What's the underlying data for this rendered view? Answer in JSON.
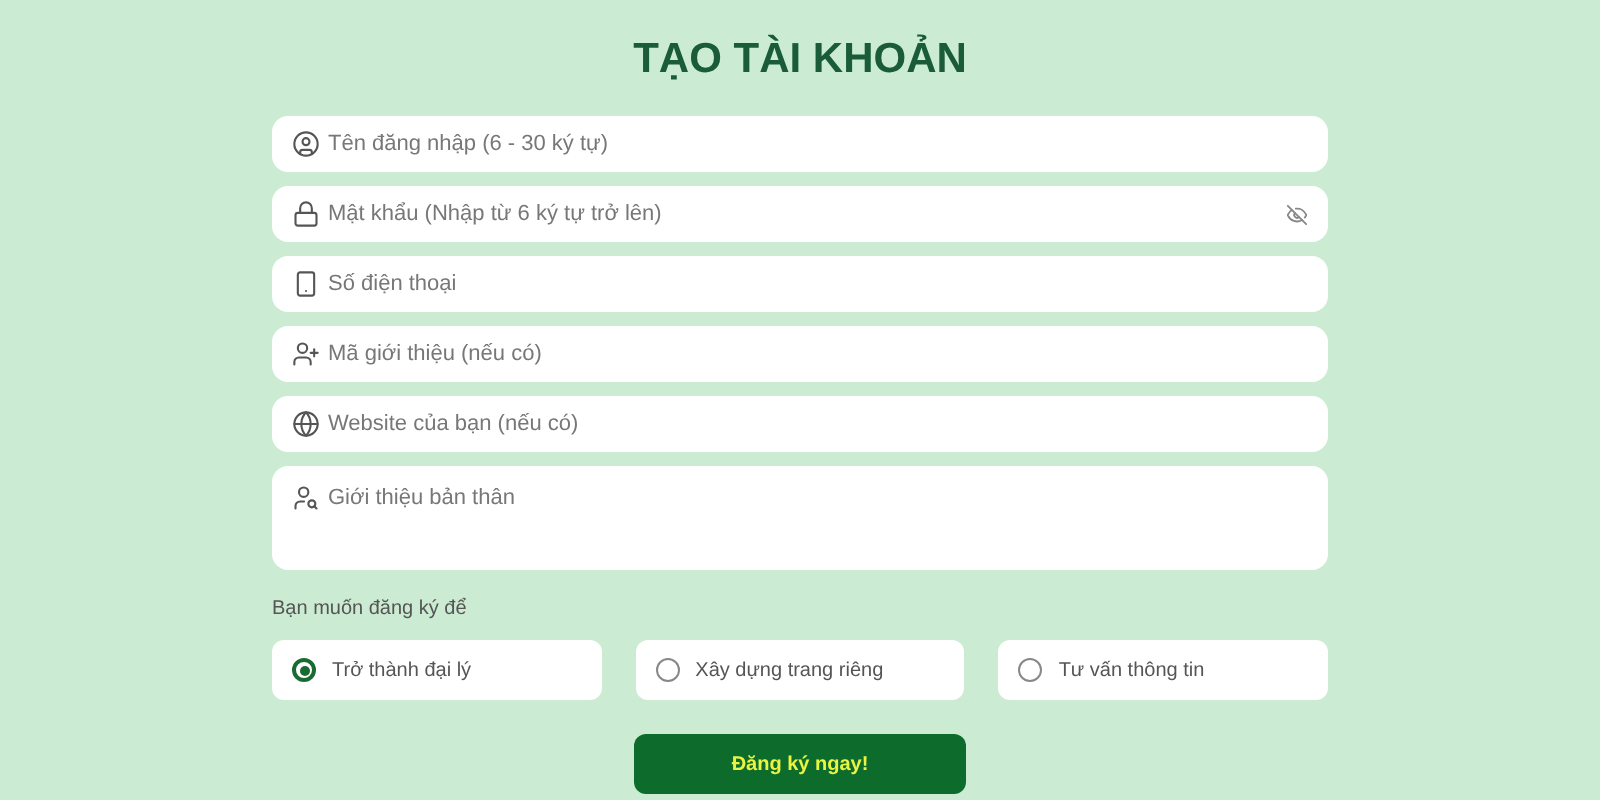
{
  "title": "TẠO TÀI KHOẢN",
  "fields": [
    {
      "kind": "text",
      "placeholder": "Tên đăng nhập (6 - 30 ký tự)"
    },
    {
      "kind": "password",
      "placeholder": "Mật khẩu (Nhập từ 6 ký tự trở lên)"
    },
    {
      "kind": "text",
      "placeholder": "Số điện thoại"
    },
    {
      "kind": "text",
      "placeholder": "Mã giới thiệu (nếu có)"
    },
    {
      "kind": "text",
      "placeholder": "Website của bạn (nếu có)"
    },
    {
      "kind": "textarea",
      "placeholder": "Giới thiệu bản thân"
    }
  ],
  "purpose": {
    "label": "Bạn muốn đăng ký để",
    "options": [
      {
        "label": "Trở thành đại lý",
        "selected": true
      },
      {
        "label": "Xây dựng trang riêng",
        "selected": false
      },
      {
        "label": "Tư vấn thông tin",
        "selected": false
      }
    ]
  },
  "submit": "Đăng ký ngay!"
}
